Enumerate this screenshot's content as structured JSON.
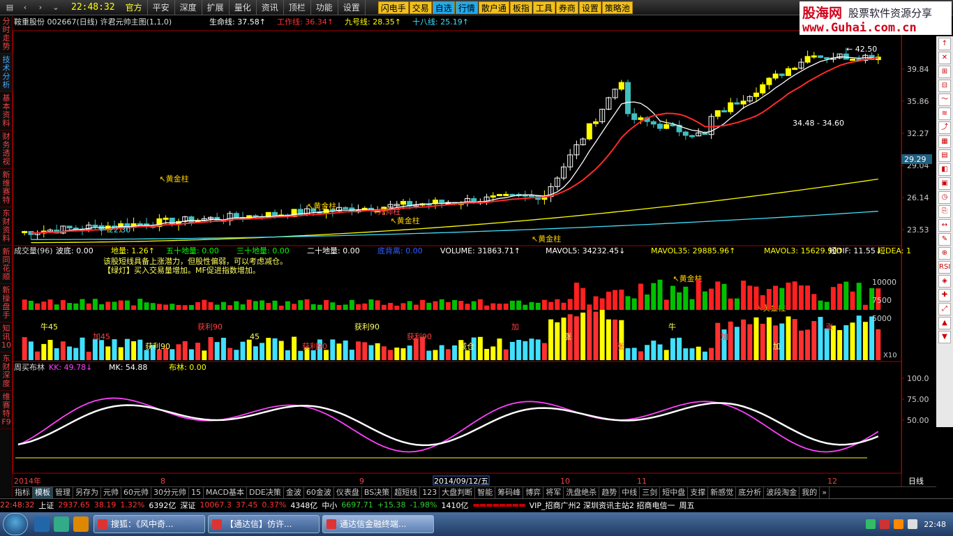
{
  "app": {
    "clock": "22:48:32",
    "menus": [
      "官方",
      "平安",
      "深度",
      "扩展",
      "量化",
      "资讯",
      "顶栏",
      "功能",
      "设置"
    ],
    "active_menu": 0,
    "quick_buttons": [
      "闪电手",
      "交易",
      "自选",
      "行情",
      "散户通",
      "板指",
      "工具",
      "券商",
      "设置",
      "策略池"
    ]
  },
  "logo": {
    "name": "股海网",
    "slogan": "股票软件资源分享",
    "url": "www.Guhai.com.cn"
  },
  "left_tabs": [
    "分时走势",
    "技术分析",
    "基本资料",
    "财务透视",
    "新维赛特",
    "东财资料",
    "新同花顺",
    "新操盘手",
    "知讯10",
    "东财深度",
    "维赛特F9"
  ],
  "left_tab_selected": 1,
  "right_tools": [
    "↑",
    "✕",
    "⊞",
    "⊟",
    "～",
    "≋",
    "⤴",
    "▦",
    "▤",
    "◧",
    "▣",
    "◷",
    "⎘",
    "↔",
    "✎",
    "⊕",
    "RSI",
    "◈",
    "✚",
    "⤢",
    "▲",
    "▼"
  ],
  "price_panel": {
    "stock": "鞍重股份",
    "code": "002667(日线)",
    "formula": "许君元帅主图(1,1,0)",
    "indicators": [
      {
        "label": "生命线:",
        "value": "37.58",
        "color": "#ffffff",
        "arrow": "↑",
        "arrow_color": "#ff4040"
      },
      {
        "label": "工作线:",
        "value": "36.34",
        "color": "#ff3030",
        "arrow": "↑",
        "arrow_color": "#ff4040"
      },
      {
        "label": "九号线:",
        "value": "28.35",
        "color": "#ffff00",
        "arrow": "↑",
        "arrow_color": "#ff4040"
      },
      {
        "label": "十八线:",
        "value": "25.19",
        "color": "#40e0ff",
        "arrow": "↑",
        "arrow_color": "#ff4040"
      }
    ],
    "y_ticks": [
      "39.84",
      "35.86",
      "32.27",
      "29.04",
      "26.14",
      "23.53"
    ],
    "current_price": "29.29",
    "high_label": "42.50",
    "low_label": "22.30",
    "range_label": "34.48 - 34.60",
    "signal_labels": [
      "黄金柱",
      "黄金柱",
      "黄金柱",
      "黄金柱",
      "黄金柱",
      "黄金柱",
      "元帅柱"
    ]
  },
  "volume_panel": {
    "title": "成交量(96)",
    "values": [
      {
        "label": "波底:",
        "value": "0.00",
        "color": "#ffffff"
      },
      {
        "label": "地量:",
        "value": "1.26",
        "color": "#ffff00",
        "arrow": "↑"
      },
      {
        "label": "五十地量:",
        "value": "0.00",
        "color": "#00ff00"
      },
      {
        "label": "三十地量:",
        "value": "0.00",
        "color": "#00ff00"
      },
      {
        "label": "二十地量:",
        "value": "0.00",
        "color": "#ffffff"
      },
      {
        "label": "底背离:",
        "value": "0.00",
        "color": "#3060ff"
      },
      {
        "label": "VOLUME:",
        "value": "31863.71",
        "color": "#ffffff",
        "arrow": "↑"
      },
      {
        "label": "MAVOL5:",
        "value": "34232.45",
        "color": "#ffffff",
        "arrow": "↓"
      },
      {
        "label": "MAVOL35:",
        "value": "29885.96",
        "color": "#ffff00",
        "arrow": "↑"
      },
      {
        "label": "MAVOL3:",
        "value": "15629.90",
        "color": "#ffff00",
        "arrow": "↑"
      }
    ],
    "right_values": [
      {
        "label": "短DIF:",
        "value": "11.55",
        "color": "#ffffff",
        "arrow": "↓"
      },
      {
        "label": "短DEA:",
        "value": "1",
        "color": "#ffff00"
      }
    ],
    "notes": [
      "该股短线具备上涨潜力，但股性偏弱，可以考虑减仓。",
      "【绿灯】买入交易量增加。MF促进指数增加。"
    ],
    "y_ticks": [
      "10000",
      "7500",
      "5000"
    ],
    "scale": "X10",
    "labels": [
      "牛45",
      "加45",
      "获利90",
      "获利90",
      "45",
      "获利90",
      "获利90",
      "获利90",
      "减仓",
      "加",
      "涨",
      "涨",
      "牛",
      "加",
      "加",
      "涨"
    ]
  },
  "osc_panel": {
    "title": "周买布林",
    "values": [
      {
        "label": "KK:",
        "value": "49.78",
        "color": "#ff40ff",
        "arrow": "↓"
      },
      {
        "label": "MK:",
        "value": "54.88",
        "color": "#ffffff"
      },
      {
        "label": "布林:",
        "value": "0.00",
        "color": "#ffff00"
      }
    ],
    "y_ticks": [
      "100.0",
      "75.00",
      "50.00"
    ]
  },
  "xaxis": {
    "labels": [
      "2014年",
      "8",
      "9",
      "2014/09/12/五",
      "10",
      "11",
      "12"
    ],
    "period": "日线"
  },
  "bottom_tabs": [
    "指标",
    "模板",
    "管理",
    "另存为",
    "元帅",
    "60元帅",
    "30分元帅",
    "15",
    "MACD基本",
    "DDE决策",
    "金波",
    "60金波",
    "仪表盘",
    "BS决策",
    "超短线",
    "123",
    "大盘判断",
    "智能",
    "筹码峰",
    "博弈",
    "将军",
    "洗盘绝杀",
    "趋势",
    "中线",
    "三剑",
    "短中盘",
    "支撑",
    "新感觉",
    "底分析",
    "波段淘金",
    "我的",
    "»"
  ],
  "bottom_tab_selected": 1,
  "status": {
    "time": "22:48:32",
    "sh_name": "上证",
    "sh_value": "2937.65",
    "sh_change": "38.19",
    "sh_pct": "1.32%",
    "sh_amt": "6392亿",
    "sz_name": "深证",
    "sz_value": "10067.3",
    "sz_change": "37.45",
    "sz_pct": "0.37%",
    "sz_amt": "4348亿",
    "zx_name": "中小",
    "zx_value": "6697.71",
    "zx_change": "+15.38",
    "zx_pct": "-1.98%",
    "zx_amt": "1410亿",
    "server": "VIP_招商广州2 深圳资讯主站2 招商电信一",
    "weekday": "周五"
  },
  "taskbar": {
    "tasks": [
      "搜狐：《风中奇...",
      "【通达信】仿许...",
      "通达信金融终端..."
    ],
    "active_task": 2,
    "tray_time": "22:48"
  },
  "chart_data": {
    "type": "candlestick",
    "x_range": [
      "2014-07",
      "2014-12"
    ],
    "y_range": [
      22,
      43
    ],
    "price_high": 42.5,
    "price_low": 22.3,
    "last_price": 29.29,
    "ma_series": [
      {
        "name": "生命线",
        "last": 37.58,
        "color": "#ffffff"
      },
      {
        "name": "工作线",
        "last": 36.34,
        "color": "#ff3030"
      },
      {
        "name": "九号线",
        "last": 28.35,
        "color": "#ffff00"
      },
      {
        "name": "十八线",
        "last": 25.19,
        "color": "#40e0ff"
      }
    ],
    "volume_range": [
      0,
      12000
    ],
    "oscillator_range": [
      0,
      100
    ],
    "osc_series": [
      {
        "name": "KK",
        "last": 49.78
      },
      {
        "name": "MK",
        "last": 54.88
      }
    ]
  }
}
